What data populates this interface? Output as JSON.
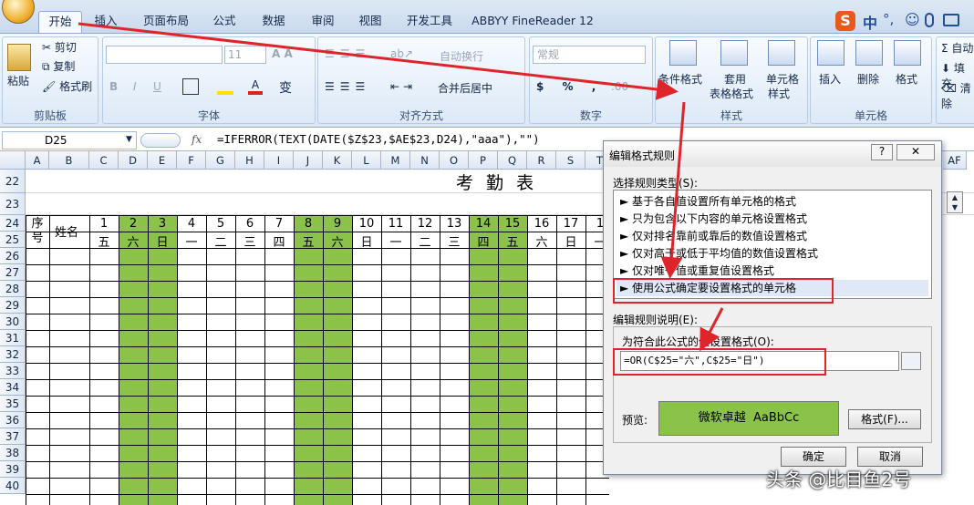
{
  "tabs": [
    "开始",
    "插入",
    "页面布局",
    "公式",
    "数据",
    "审阅",
    "视图",
    "开发工具",
    "ABBYY FineReader 12"
  ],
  "ime": {
    "logo": "S",
    "lang": "中",
    "punct": "°,"
  },
  "ribbon": {
    "clipboard": {
      "paste": "粘贴",
      "cut": "剪切",
      "copy": "复制",
      "format_painter": "格式刷",
      "label": "剪贴板"
    },
    "font": {
      "font_size": "11",
      "label": "字体"
    },
    "alignment": {
      "wrap": "自动换行",
      "merge": "合并后居中",
      "label": "对齐方式"
    },
    "number": {
      "format": "常规",
      "label": "数字"
    },
    "styles": {
      "cond_format_1": "条件格式",
      "table_format_1": "套用",
      "table_format_2": "表格格式",
      "cell_style_1": "单元格",
      "cell_style_2": "样式",
      "label": "样式"
    },
    "cells": {
      "insert": "插入",
      "delete": "删除",
      "format": "格式",
      "label": "单元格"
    },
    "editing": {
      "sum": "自动",
      "fill": "填充",
      "clear": "清除"
    }
  },
  "formula_bar": {
    "name_box": "D25",
    "fx": "fx",
    "formula": "=IFERROR(TEXT(DATE($Z$23,$AE$23,D24),\"aaa\"),\"\")"
  },
  "sheet": {
    "title": "考  勤  表",
    "columns": [
      "A",
      "B",
      "C",
      "D",
      "E",
      "F",
      "G",
      "H",
      "I",
      "J",
      "K",
      "L",
      "M",
      "N",
      "O",
      "P",
      "Q",
      "R",
      "S",
      "T"
    ],
    "far_column": "AF",
    "rows": [
      "22",
      "23",
      "24",
      "25",
      "26",
      "27",
      "28",
      "29",
      "30",
      "31",
      "32",
      "33",
      "34",
      "35",
      "36",
      "37",
      "38",
      "39",
      "40"
    ],
    "header_seq": "序号",
    "header_name": "姓名",
    "days": [
      "1",
      "2",
      "3",
      "4",
      "5",
      "6",
      "7",
      "8",
      "9",
      "10",
      "11",
      "12",
      "13",
      "14",
      "15",
      "16",
      "17",
      "1"
    ],
    "weekdays": [
      "五",
      "六",
      "日",
      "一",
      "二",
      "三",
      "四",
      "五",
      "六",
      "日",
      "一",
      "二",
      "三",
      "四",
      "五",
      "六",
      "日",
      "一"
    ]
  },
  "dialog": {
    "title": "编辑格式规则",
    "help": "?",
    "close": "✕",
    "rule_type_label": "选择规则类型(S):",
    "rules": [
      "► 基于各自值设置所有单元格的格式",
      "► 只为包含以下内容的单元格设置格式",
      "► 仅对排名靠前或靠后的数值设置格式",
      "► 仅对高于或低于平均值的数值设置格式",
      "► 仅对唯一值或重复值设置格式",
      "► 使用公式确定要设置格式的单元格"
    ],
    "desc_label": "编辑规则说明(E):",
    "formula_label": "为符合此公式的值设置格式(O):",
    "formula": "=OR(C$25=\"六\",C$25=\"日\")",
    "preview_label": "预览:",
    "preview_text": "微软卓越  AaBbCc",
    "format_button": "格式(F)...",
    "ok": "确定",
    "cancel": "取消"
  },
  "watermark": "头条 @比目鱼2号",
  "colors": {
    "highlight": "#8ac24a",
    "annotation": "#e0242b"
  }
}
